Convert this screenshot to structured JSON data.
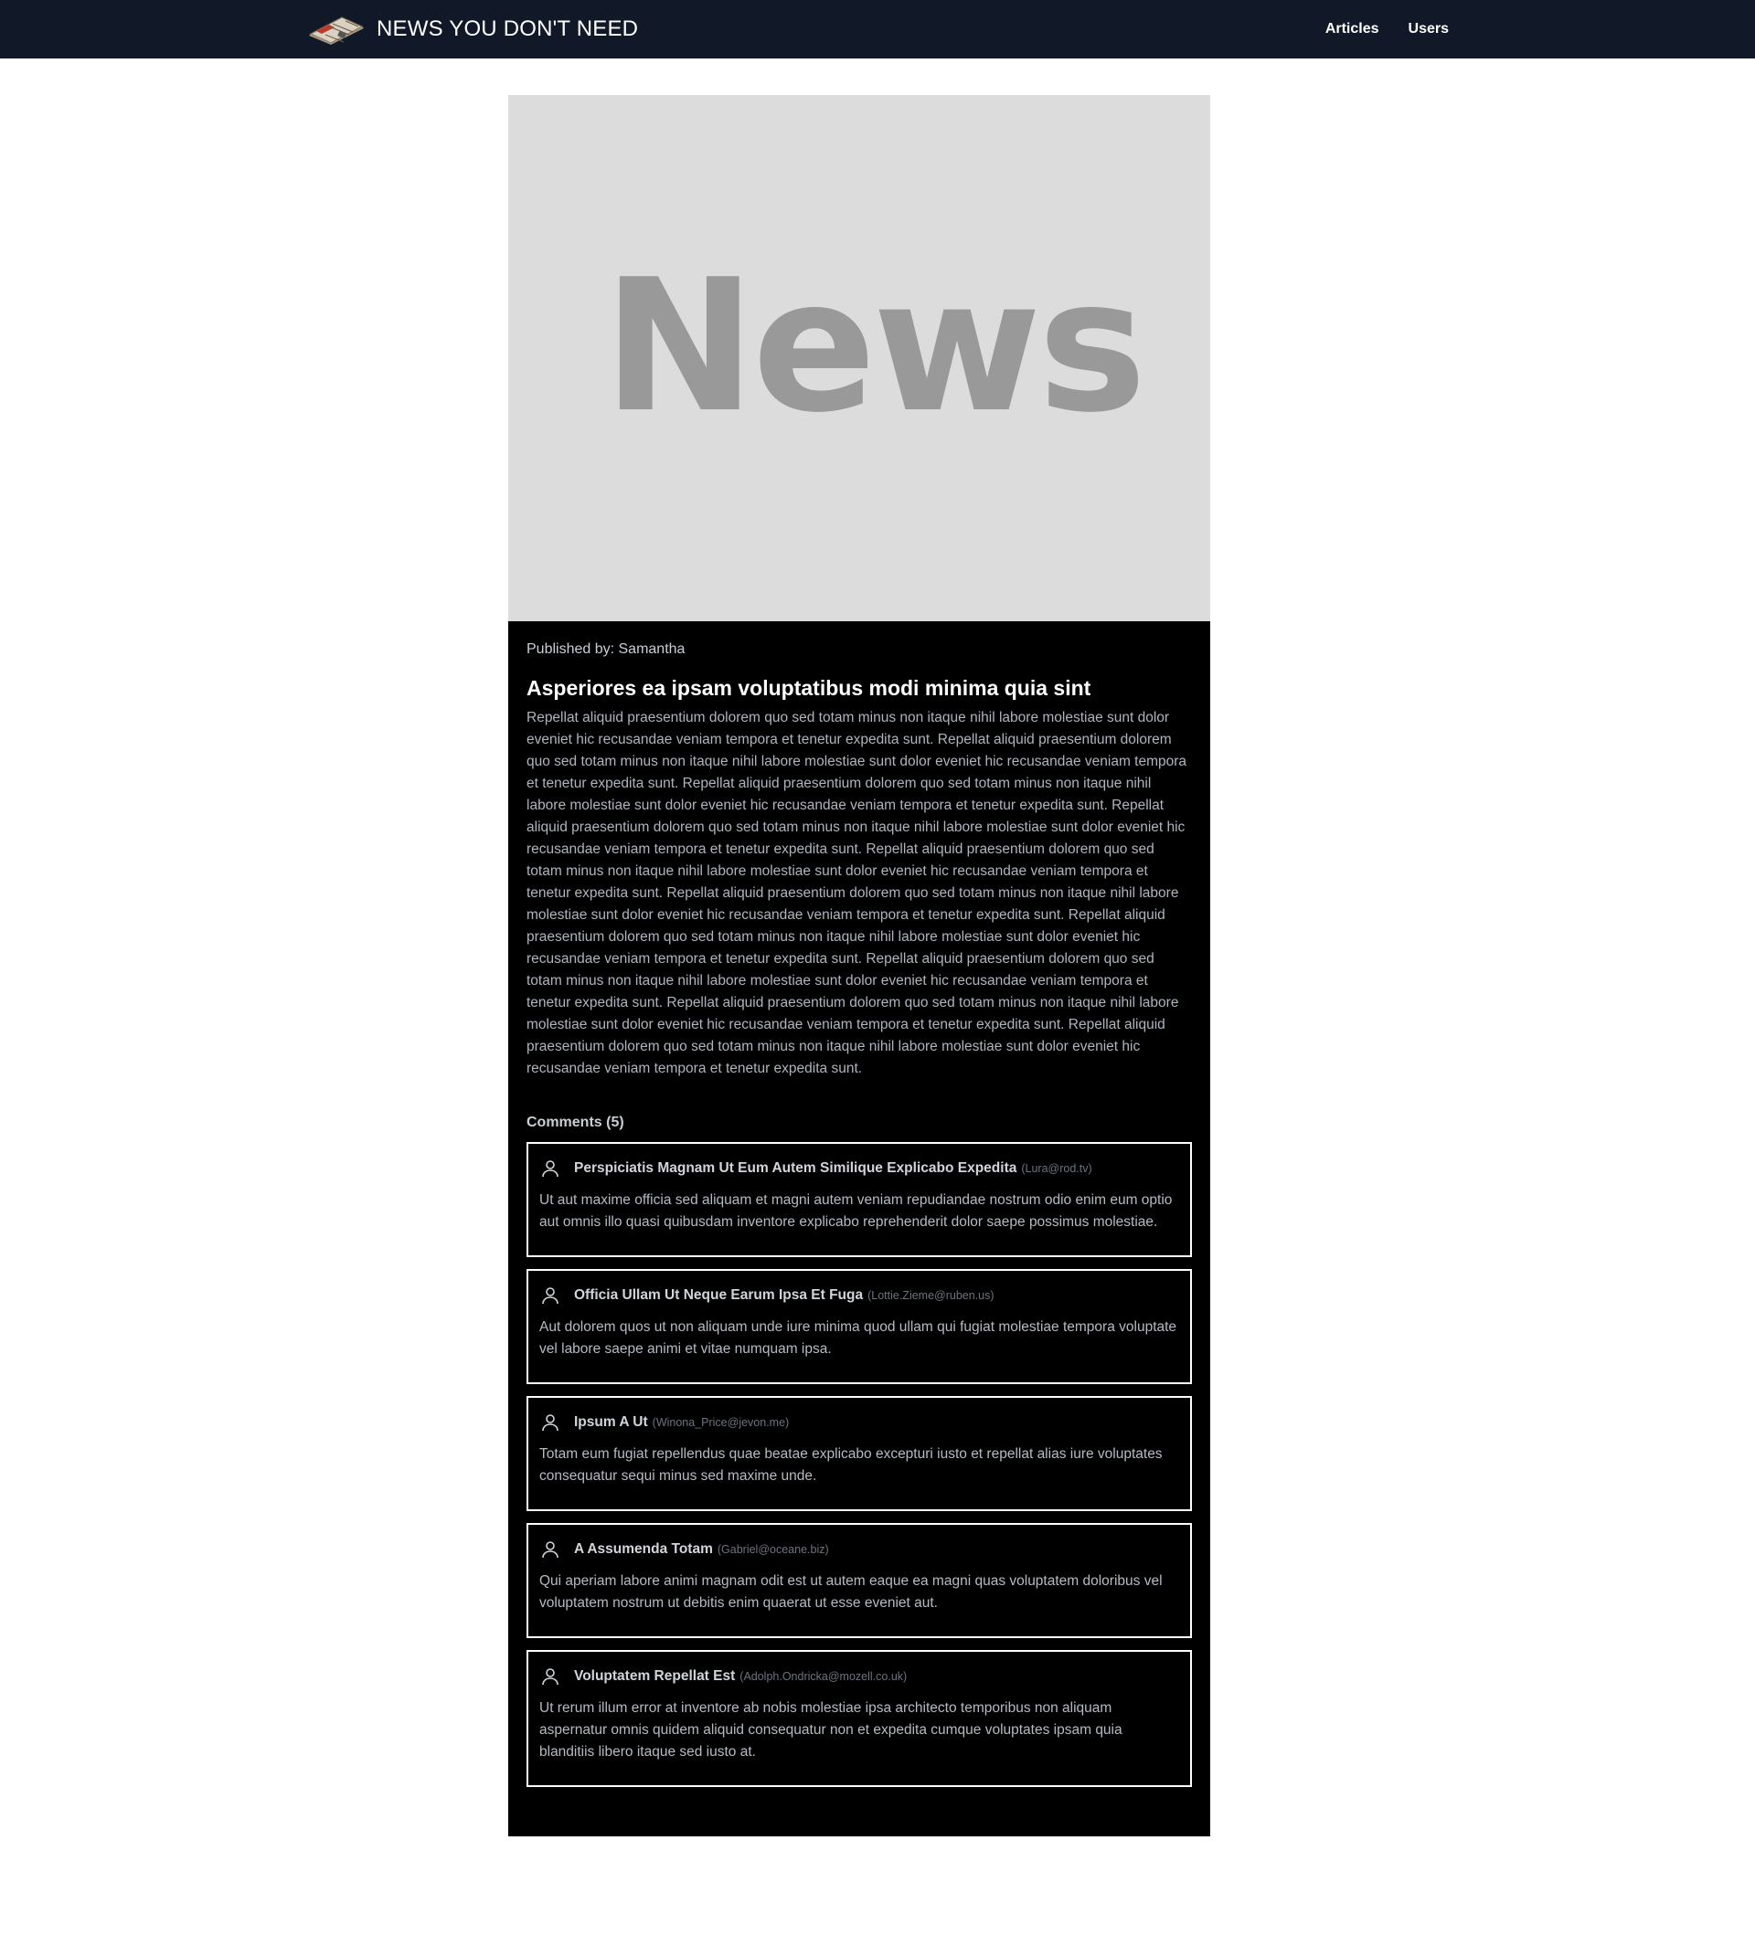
{
  "navbar": {
    "brand_title": "NEWS YOU DON'T NEED",
    "logo_icon": "newspaper-icon",
    "links": [
      {
        "label": "Articles"
      },
      {
        "label": "Users"
      }
    ],
    "background": "#111827"
  },
  "article": {
    "hero_text": "News",
    "published_by": "Published by: Samantha",
    "title": "Asperiores ea ipsam voluptatibus modi minima quia sint",
    "body": "Repellat aliquid praesentium dolorem quo sed totam minus non itaque nihil labore molestiae sunt dolor eveniet hic recusandae veniam tempora et tenetur expedita sunt. Repellat aliquid praesentium dolorem quo sed totam minus non itaque nihil labore molestiae sunt dolor eveniet hic recusandae veniam tempora et tenetur expedita sunt. Repellat aliquid praesentium dolorem quo sed totam minus non itaque nihil labore molestiae sunt dolor eveniet hic recusandae veniam tempora et tenetur expedita sunt. Repellat aliquid praesentium dolorem quo sed totam minus non itaque nihil labore molestiae sunt dolor eveniet hic recusandae veniam tempora et tenetur expedita sunt. Repellat aliquid praesentium dolorem quo sed totam minus non itaque nihil labore molestiae sunt dolor eveniet hic recusandae veniam tempora et tenetur expedita sunt. Repellat aliquid praesentium dolorem quo sed totam minus non itaque nihil labore molestiae sunt dolor eveniet hic recusandae veniam tempora et tenetur expedita sunt. Repellat aliquid praesentium dolorem quo sed totam minus non itaque nihil labore molestiae sunt dolor eveniet hic recusandae veniam tempora et tenetur expedita sunt. Repellat aliquid praesentium dolorem quo sed totam minus non itaque nihil labore molestiae sunt dolor eveniet hic recusandae veniam tempora et tenetur expedita sunt. Repellat aliquid praesentium dolorem quo sed totam minus non itaque nihil labore molestiae sunt dolor eveniet hic recusandae veniam tempora et tenetur expedita sunt. Repellat aliquid praesentium dolorem quo sed totam minus non itaque nihil labore molestiae sunt dolor eveniet hic recusandae veniam tempora et tenetur expedita sunt."
  },
  "comments": {
    "heading": "Comments (5)",
    "items": [
      {
        "name": "Perspiciatis Magnam Ut Eum Autem Similique Explicabo Expedita",
        "email": "(Lura@rod.tv)",
        "body": "Ut aut maxime officia sed aliquam et magni autem veniam repudiandae nostrum odio enim eum optio aut omnis illo quasi quibusdam inventore explicabo reprehenderit dolor saepe possimus molestiae."
      },
      {
        "name": "Officia Ullam Ut Neque Earum Ipsa Et Fuga",
        "email": "(Lottie.Zieme@ruben.us)",
        "body": "Aut dolorem quos ut non aliquam unde iure minima quod ullam qui fugiat molestiae tempora voluptate vel labore saepe animi et vitae numquam ipsa."
      },
      {
        "name": "Ipsum A Ut",
        "email": "(Winona_Price@jevon.me)",
        "body": "Totam eum fugiat repellendus quae beatae explicabo excepturi iusto et repellat alias iure voluptates consequatur sequi minus sed maxime unde."
      },
      {
        "name": "A Assumenda Totam",
        "email": "(Gabriel@oceane.biz)",
        "body": "Qui aperiam labore animi magnam odit est ut autem eaque ea magni quas voluptatem doloribus vel voluptatem nostrum ut debitis enim quaerat ut esse eveniet aut."
      },
      {
        "name": "Voluptatem Repellat Est",
        "email": "(Adolph.Ondricka@mozell.co.uk)",
        "body": "Ut rerum illum error at inventore ab nobis molestiae ipsa architecto temporibus non aliquam aspernatur omnis quidem aliquid consequatur non et expedita cumque voluptates ipsam quia blanditiis libero itaque sed iusto at."
      }
    ]
  }
}
